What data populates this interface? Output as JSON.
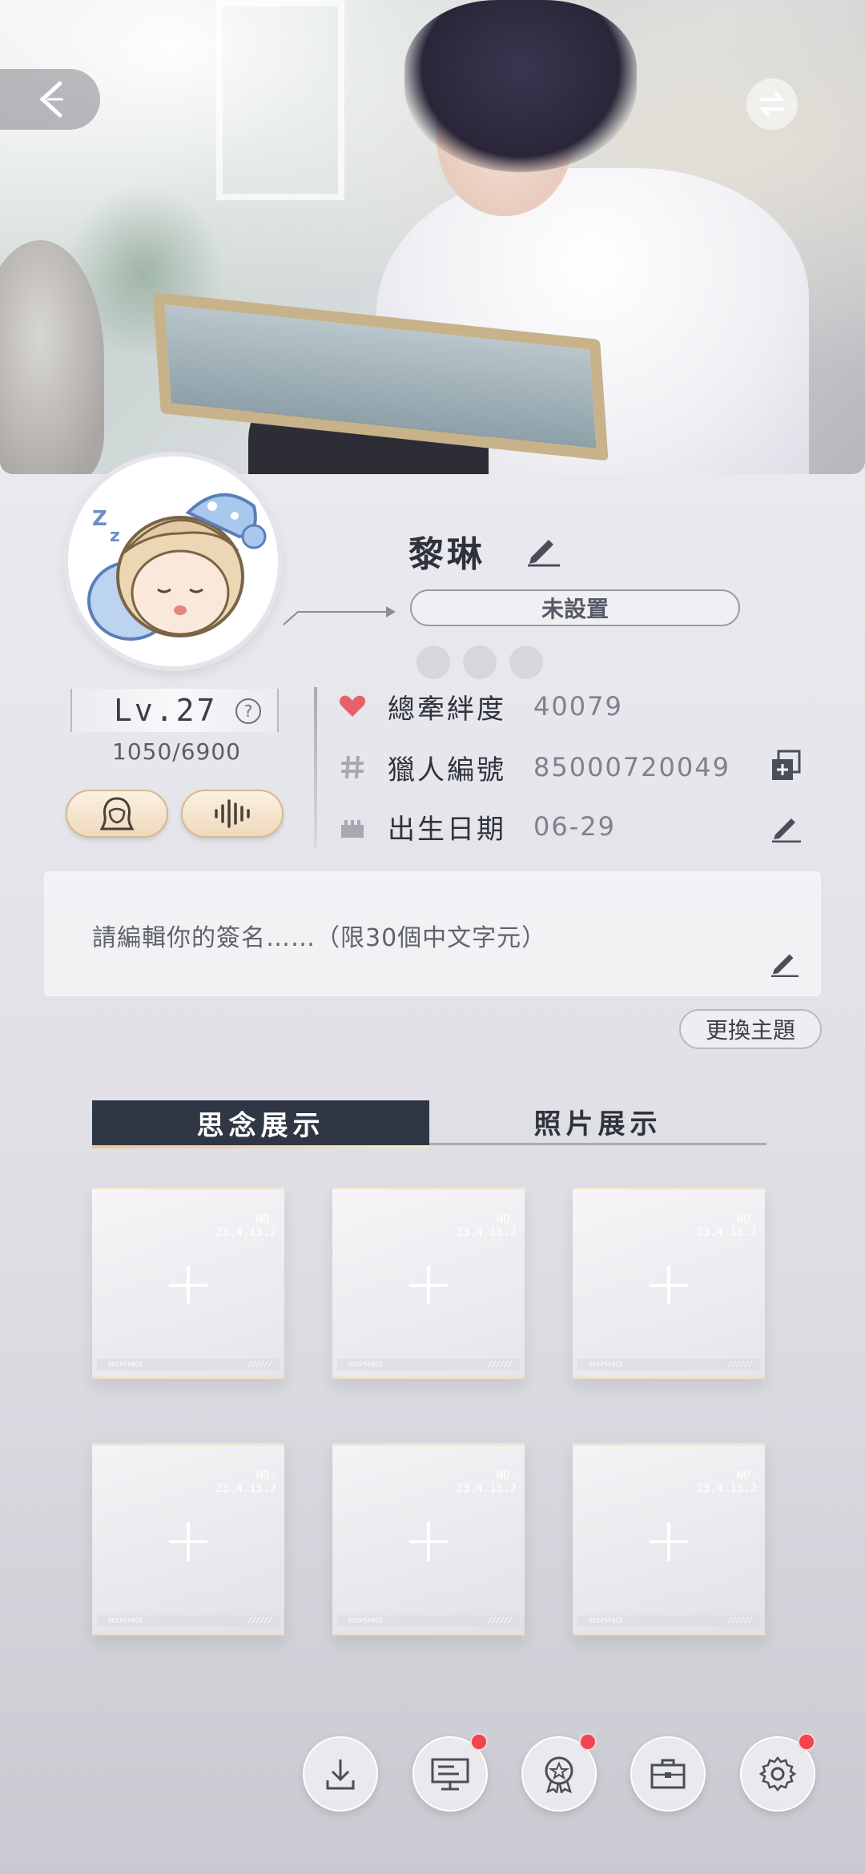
{
  "profile": {
    "name": "黎琳",
    "title": "未設置",
    "level": "Lv.27",
    "level_help": "?",
    "exp": "1050/6900"
  },
  "info": {
    "bond": {
      "label": "總牽絆度",
      "value": "40079"
    },
    "hunter_id": {
      "label": "獵人編號",
      "value": "85000720049"
    },
    "birthday": {
      "label": "出生日期",
      "value": "06-29"
    }
  },
  "signature": {
    "placeholder": "請編輯你的簽名……（限30個中文字元）"
  },
  "theme_button": "更換主題",
  "tabs": [
    {
      "label": "思念展示",
      "active": true
    },
    {
      "label": "照片展示",
      "active": false
    }
  ],
  "cards": [
    {
      "no": "NO.",
      "code": "23.4.15.2",
      "footer": "DEEPSPACE"
    },
    {
      "no": "NO.",
      "code": "23.4.15.2",
      "footer": "DEEPSPACE"
    },
    {
      "no": "NO.",
      "code": "23.4.15.2",
      "footer": "DEEPSPACE"
    },
    {
      "no": "NO.",
      "code": "23.4.15.2",
      "footer": "DEEPSPACE"
    },
    {
      "no": "NO.",
      "code": "23.4.15.2",
      "footer": "DEEPSPACE"
    },
    {
      "no": "NO.",
      "code": "23.4.15.2",
      "footer": "DEEPSPACE"
    }
  ],
  "bottom_bar": [
    {
      "icon": "download-icon",
      "badge": false
    },
    {
      "icon": "display-board-icon",
      "badge": true
    },
    {
      "icon": "medal-icon",
      "badge": true
    },
    {
      "icon": "briefcase-icon",
      "badge": false
    },
    {
      "icon": "gear-icon",
      "badge": true
    }
  ],
  "colors": {
    "accent_dark": "#2f3744",
    "badge_red": "#f0454e",
    "heart_red": "#e8606a",
    "pill_gold": "#efd9bb"
  }
}
